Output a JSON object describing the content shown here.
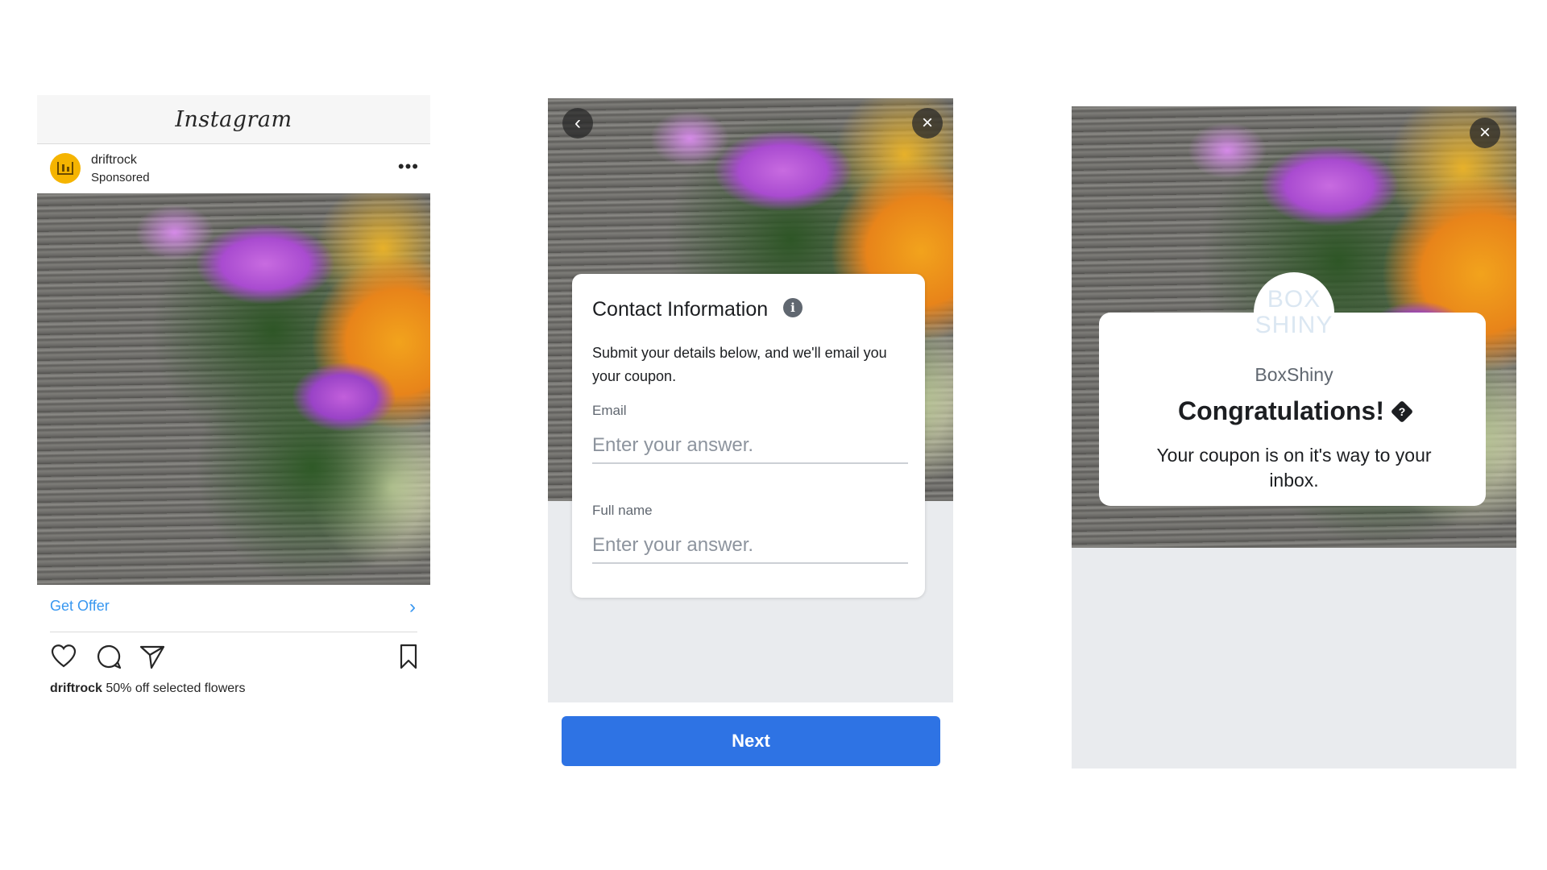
{
  "instagram": {
    "logo": "Instagram",
    "account_name": "driftrock",
    "sponsored_label": "Sponsored",
    "more_icon": "more-horizontal-icon",
    "cta_label": "Get Offer",
    "caption_user": "driftrock",
    "caption_text": " 50% off selected flowers",
    "icons": [
      "heart-icon",
      "comment-icon",
      "send-icon",
      "bookmark-icon"
    ],
    "link_color": "#3897f0"
  },
  "lead_form": {
    "title": "Contact Information",
    "description": "Submit your details below, and we'll email you your coupon.",
    "fields": [
      {
        "label": "Email",
        "placeholder": "Enter your answer."
      },
      {
        "label": "Full name",
        "placeholder": "Enter your answer."
      }
    ],
    "next_label": "Next",
    "button_color": "#2e73e4"
  },
  "confirmation": {
    "logo_line1": "BOX",
    "logo_line2": "SHINY",
    "brand_name": "BoxShiny",
    "heading": "Congratulations!",
    "message": "Your coupon is on it's way to your inbox."
  }
}
